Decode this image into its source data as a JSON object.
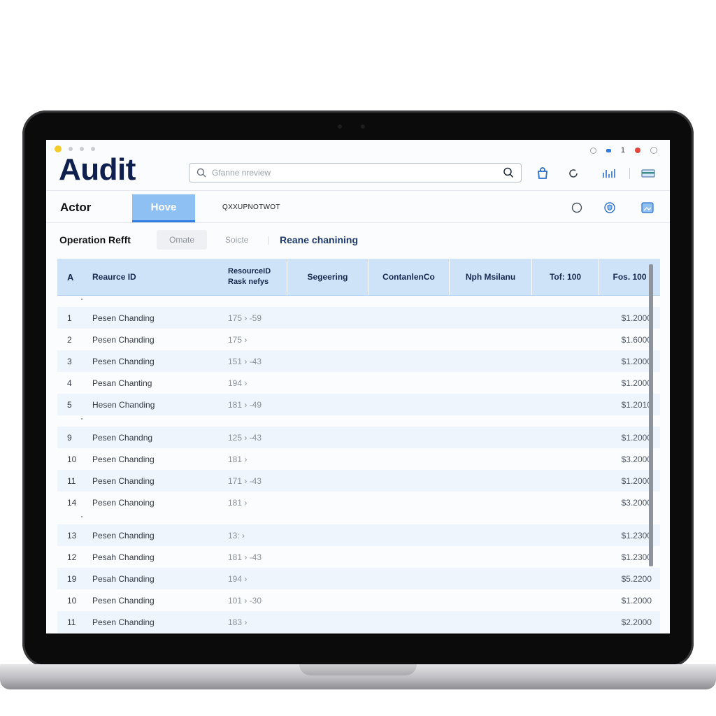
{
  "app": {
    "title": "Audit",
    "search_placeholder": "Gfanne nreview",
    "top_number": "1"
  },
  "nav": {
    "label": "Actor",
    "active_tab": "Hove",
    "code_text": "QXXUPNOTWOT"
  },
  "filters": {
    "label": "Operation Refft",
    "chip": "Omate",
    "plain": "Soicte",
    "link": "Reane chanining"
  },
  "icons": {
    "header_right": [
      "bag-icon",
      "circle-arrow-icon",
      "chart-icon",
      "card-icon"
    ],
    "nav_right": [
      "circle-icon",
      "shield-icon",
      "image-icon"
    ],
    "accent_color": "#2f7de1",
    "header_bg": "#cfe3f8"
  },
  "table": {
    "headers": {
      "c0": "A",
      "c1": "Reaurce ID",
      "c2a": "ResourceID",
      "c2b": "Rask nefys",
      "c3": "Segeering",
      "c4": "ContanlenCo",
      "c5": "Nph Msilanu",
      "c6": "Tof: 100",
      "c7": "Fos. 100"
    },
    "groups": [
      [
        {
          "num": "1",
          "name": "Pesen Chanding",
          "res": "175 › -59",
          "amt": "$1.2000"
        },
        {
          "num": "2",
          "name": "Pesen Chanding",
          "res": "175 ›",
          "amt": "$1.6000"
        },
        {
          "num": "3",
          "name": "Pesen Chanding",
          "res": "151 › -43",
          "amt": "$1.2000"
        },
        {
          "num": "4",
          "name": "Pesan Chanting",
          "res": "194 ›",
          "amt": "$1.2000"
        },
        {
          "num": "5",
          "name": "Hesen Chanding",
          "res": "181 › -49",
          "amt": "$1.2010"
        }
      ],
      [
        {
          "num": "9",
          "name": "Pesen Chandng",
          "res": "125 › -43",
          "amt": "$1.2000"
        },
        {
          "num": "10",
          "name": "Pesen Chanding",
          "res": "181 ›",
          "amt": "$3.2000"
        },
        {
          "num": "11",
          "name": "Pesen Chanding",
          "res": "171 › -43",
          "amt": "$1.2000"
        },
        {
          "num": "14",
          "name": "Pesen Chanoing",
          "res": "181 ›",
          "amt": "$3.2000"
        }
      ],
      [
        {
          "num": "13",
          "name": "Pesen Chanding",
          "res": "13: ›",
          "amt": "$1.2300"
        },
        {
          "num": "12",
          "name": "Pesah Chanding",
          "res": "181 › -43",
          "amt": "$1.2300"
        },
        {
          "num": "19",
          "name": "Pesah Chanding",
          "res": "194 ›",
          "amt": "$5.2200"
        },
        {
          "num": "10",
          "name": "Pesen Chanding",
          "res": "101 › -30",
          "amt": "$1.2000"
        },
        {
          "num": "11",
          "name": "Pesen Chanding",
          "res": "183 ›",
          "amt": "$2.2000"
        }
      ]
    ]
  }
}
